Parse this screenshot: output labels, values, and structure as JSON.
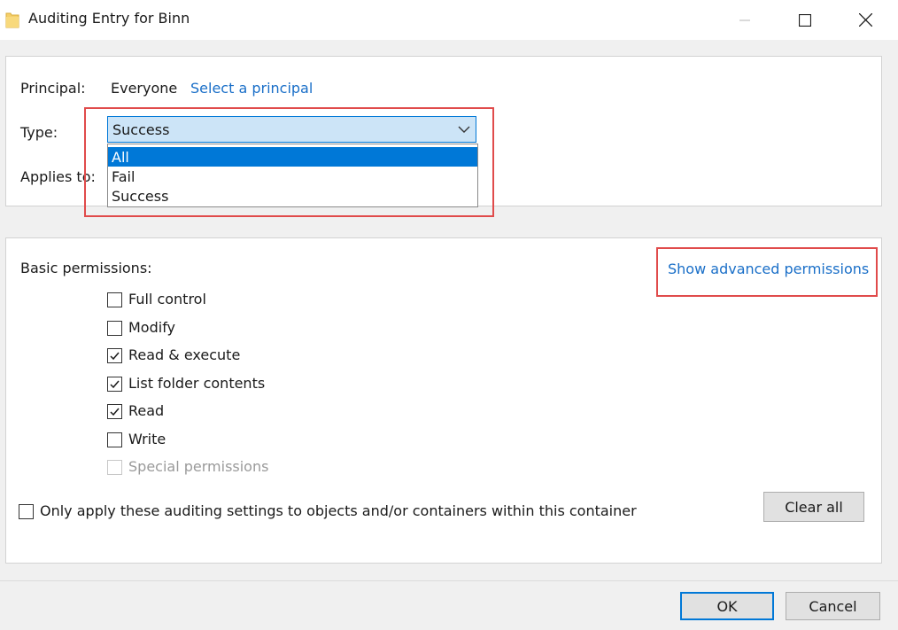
{
  "window": {
    "title": "Auditing Entry for Binn"
  },
  "principal": {
    "label": "Principal:",
    "value": "Everyone",
    "select_link": "Select a principal"
  },
  "type": {
    "label": "Type:",
    "selected": "Success",
    "options": [
      "All",
      "Fail",
      "Success"
    ],
    "highlighted_option": "All"
  },
  "applies_to": {
    "label": "Applies to:"
  },
  "permissions": {
    "label": "Basic permissions:",
    "advanced_link": "Show advanced permissions",
    "items": [
      {
        "label": "Full control",
        "checked": false,
        "enabled": true
      },
      {
        "label": "Modify",
        "checked": false,
        "enabled": true
      },
      {
        "label": "Read & execute",
        "checked": true,
        "enabled": true
      },
      {
        "label": "List folder contents",
        "checked": true,
        "enabled": true
      },
      {
        "label": "Read",
        "checked": true,
        "enabled": true
      },
      {
        "label": "Write",
        "checked": false,
        "enabled": true
      },
      {
        "label": "Special permissions",
        "checked": false,
        "enabled": false
      }
    ],
    "only_apply_label": "Only apply these auditing settings to objects and/or containers within this container",
    "only_apply_checked": false,
    "clear_all": "Clear all"
  },
  "footer": {
    "ok": "OK",
    "cancel": "Cancel"
  },
  "colors": {
    "accent": "#0078d7",
    "link": "#1a6fc8",
    "highlight": "#e04b4b",
    "dialog_bg": "#f0f0f0"
  }
}
